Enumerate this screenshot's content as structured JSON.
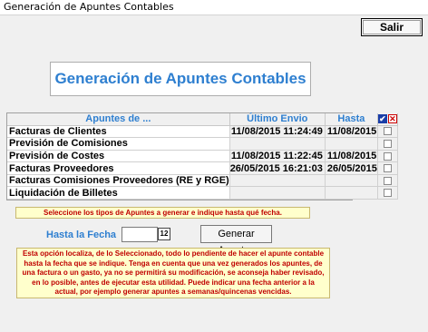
{
  "window": {
    "title": "Generación de Apuntes Contables"
  },
  "toolbar": {
    "salir_label": "Salir"
  },
  "header": {
    "title": "Generación de Apuntes Contables"
  },
  "grid": {
    "columns": [
      "Apuntes de ...",
      "Último Envio",
      "Hasta"
    ],
    "rows": [
      {
        "name": "Facturas de Clientes",
        "ultimo": "11/08/2015 11:24:49",
        "hasta": "11/08/2015"
      },
      {
        "name": "Previsión de Comisiones",
        "ultimo": "",
        "hasta": ""
      },
      {
        "name": "Previsión de Costes",
        "ultimo": "11/08/2015 11:22:45",
        "hasta": "11/08/2015"
      },
      {
        "name": "Facturas Proveedores",
        "ultimo": "26/05/2015 16:21:03",
        "hasta": "26/05/2015"
      },
      {
        "name": "Facturas Comisiones Proveedores (RE y RGE)",
        "ultimo": "",
        "hasta": ""
      },
      {
        "name": "Liquidación de Billetes",
        "ultimo": "",
        "hasta": ""
      }
    ]
  },
  "notes": {
    "select_hint": "Seleccione los tipos de Apuntes a generar e indique hasta qué fecha.",
    "info_lines": [
      "Esta opción localiza, de lo Seleccionado, todo lo pendiente de hacer el apunte contable",
      "hasta la fecha que se indique. Tenga en cuenta que una vez generados los apuntes, de",
      "una factura o un gasto, ya no se permitirá su modificación, se aconseja haber revisado,",
      "en lo posible, antes de ejecutar esta utilidad. Puede indicar una fecha anterior a la",
      "actual, por ejemplo generar apuntes a semanas/quincenas vencidas."
    ]
  },
  "form": {
    "hasta_label": "Hasta la Fecha",
    "fecha_value": "",
    "cal_icon_text": "12",
    "generar_prefix": "Generar ",
    "generar_underlined": "A",
    "generar_suffix": "puntes"
  }
}
